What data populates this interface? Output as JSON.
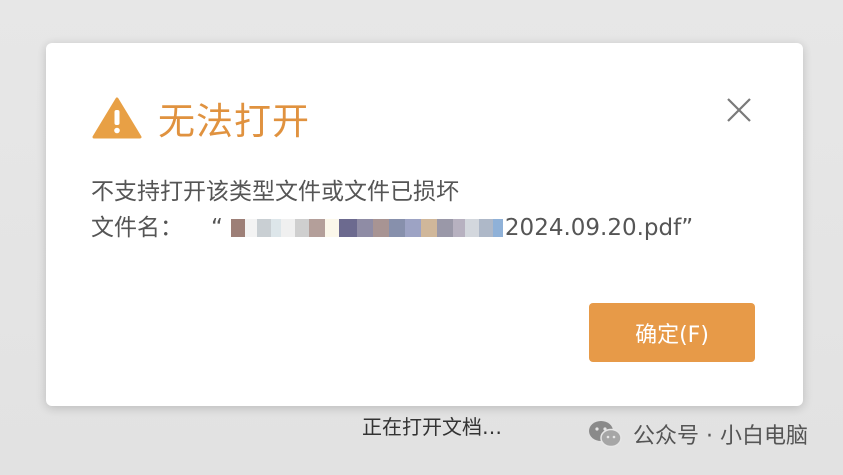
{
  "dialog": {
    "title": "无法打开",
    "message": "不支持打开该类型文件或文件已损坏",
    "filename_label": "文件名：",
    "filename_quote_open": "“",
    "filename_visible_tail": "2024.09.20.pdf”",
    "confirm_button_label": "确定(F)",
    "icons": {
      "warning": "warning-icon",
      "close": "close-icon"
    }
  },
  "status": {
    "text": "正在打开文档…"
  },
  "watermark": {
    "text": "公众号 · 小白电脑",
    "icon": "wechat-icon"
  },
  "colors": {
    "title": "#e0923f",
    "warning_icon": "#e8a045",
    "button": "#e79a48",
    "button_text": "#ffffff",
    "body_text": "#555555",
    "backdrop": "#e6e6e6"
  }
}
